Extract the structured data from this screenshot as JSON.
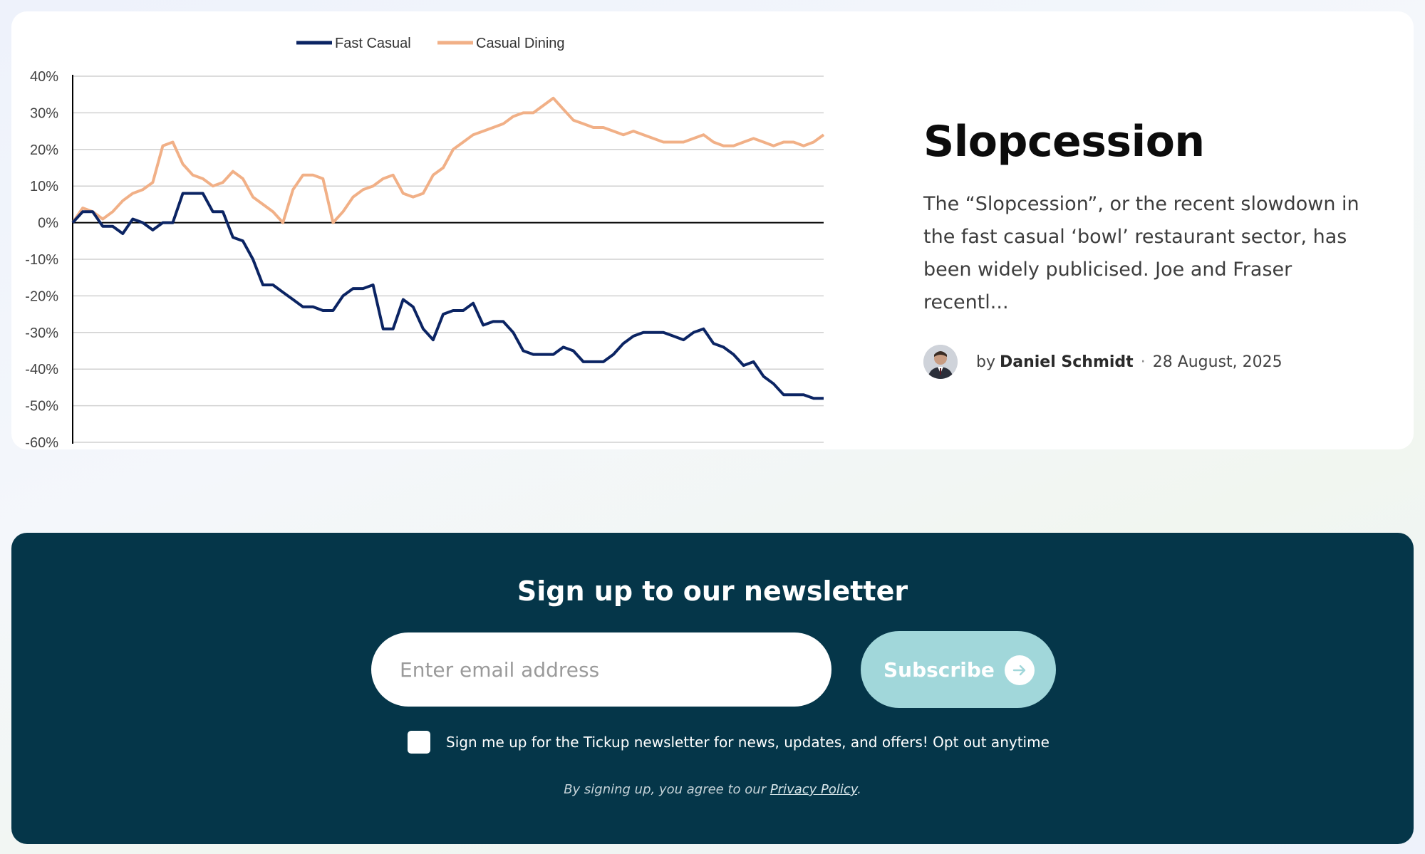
{
  "article": {
    "title": "Slopcession",
    "excerpt": "The “Slopcession”, or the recent slowdown in the fast casual ‘bowl’ restaurant sector, has been widely publicised. Joe and Fraser recentl...",
    "by_prefix": "by",
    "author": "Daniel Schmidt",
    "separator": "·",
    "date": "28 August, 2025"
  },
  "newsletter": {
    "title": "Sign up to our newsletter",
    "email_placeholder": "Enter email address",
    "subscribe_label": "Subscribe",
    "consent_text": "Sign me up for the Tickup newsletter for news, updates, and offers! Opt out anytime",
    "legal_prefix": "By signing up, you agree to our",
    "privacy_link": "Privacy Policy",
    "legal_suffix": "."
  },
  "colors": {
    "fast_casual": "#0b2463",
    "casual_dining": "#f1b087",
    "newsletter_bg": "#053649",
    "subscribe_bg": "#a1d7da"
  },
  "icons": {
    "subscribe_arrow": "arrow-right-icon"
  },
  "chart_data": {
    "type": "line",
    "title": "",
    "xlabel": "",
    "ylabel": "",
    "ylim": [
      -60,
      40
    ],
    "yticks": [
      40,
      30,
      20,
      10,
      0,
      -10,
      -20,
      -30,
      -40,
      -50,
      -60
    ],
    "ytick_labels": [
      "40%",
      "30%",
      "20%",
      "10%",
      "0%",
      "-10%",
      "-20%",
      "-30%",
      "-40%",
      "-50%",
      "-60%"
    ],
    "grid": true,
    "legend_position": "top-center",
    "series": [
      {
        "name": "Fast Casual",
        "values": [
          0,
          3,
          3,
          -1,
          -1,
          -3,
          1,
          0,
          -2,
          0,
          0,
          8,
          8,
          8,
          3,
          3,
          -4,
          -5,
          -10,
          -17,
          -17,
          -19,
          -21,
          -23,
          -23,
          -24,
          -24,
          -20,
          -18,
          -18,
          -17,
          -29,
          -29,
          -21,
          -23,
          -29,
          -32,
          -25,
          -24,
          -24,
          -22,
          -28,
          -27,
          -27,
          -30,
          -35,
          -36,
          -36,
          -36,
          -34,
          -35,
          -38,
          -38,
          -38,
          -36,
          -33,
          -31,
          -30,
          -30,
          -30,
          -31,
          -32,
          -30,
          -29,
          -33,
          -34,
          -36,
          -39,
          -38,
          -42,
          -44,
          -47,
          -47,
          -47,
          -48,
          -48
        ]
      },
      {
        "name": "Casual Dining",
        "values": [
          0,
          4,
          3,
          1,
          3,
          6,
          8,
          9,
          11,
          21,
          22,
          16,
          13,
          12,
          10,
          11,
          14,
          12,
          7,
          5,
          3,
          0,
          9,
          13,
          13,
          12,
          0,
          3,
          7,
          9,
          10,
          12,
          13,
          8,
          7,
          8,
          13,
          15,
          20,
          22,
          24,
          25,
          26,
          27,
          29,
          30,
          30,
          32,
          34,
          31,
          28,
          27,
          26,
          26,
          25,
          24,
          25,
          24,
          23,
          22,
          22,
          22,
          23,
          24,
          22,
          21,
          21,
          22,
          23,
          22,
          21,
          22,
          22,
          21,
          22,
          24
        ]
      }
    ]
  }
}
